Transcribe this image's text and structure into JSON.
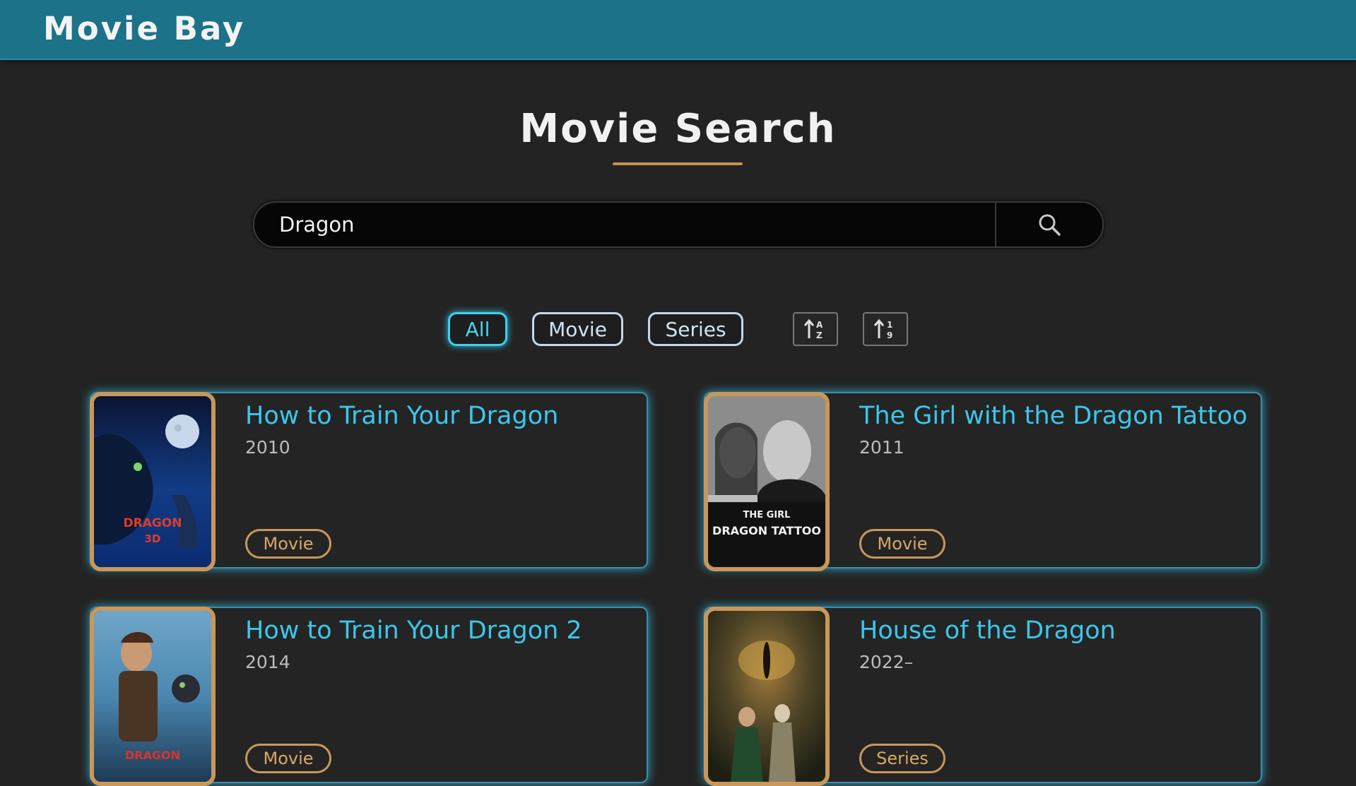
{
  "navbar": {
    "brand": "Movie Bay"
  },
  "page": {
    "title": "Movie Search"
  },
  "search": {
    "value": "Dragon",
    "placeholder": ""
  },
  "filters": {
    "all": "All",
    "movie": "Movie",
    "series": "Series",
    "active": "All"
  },
  "sort": {
    "asc_icon": "sort-alpha-ascending-icon",
    "desc_icon": "sort-numeric-descending-icon"
  },
  "colors": {
    "navbar": "#1c7288",
    "background": "#232323",
    "accent_cyan": "#3bc7ea",
    "accent_gold": "#c9975a"
  },
  "results": [
    {
      "title": "How to Train Your Dragon",
      "year": "2010",
      "type": "Movie"
    },
    {
      "title": "The Girl with the Dragon Tattoo",
      "year": "2011",
      "type": "Movie"
    },
    {
      "title": "How to Train Your Dragon 2",
      "year": "2014",
      "type": "Movie"
    },
    {
      "title": "House of the Dragon",
      "year": "2022–",
      "type": "Series"
    }
  ]
}
